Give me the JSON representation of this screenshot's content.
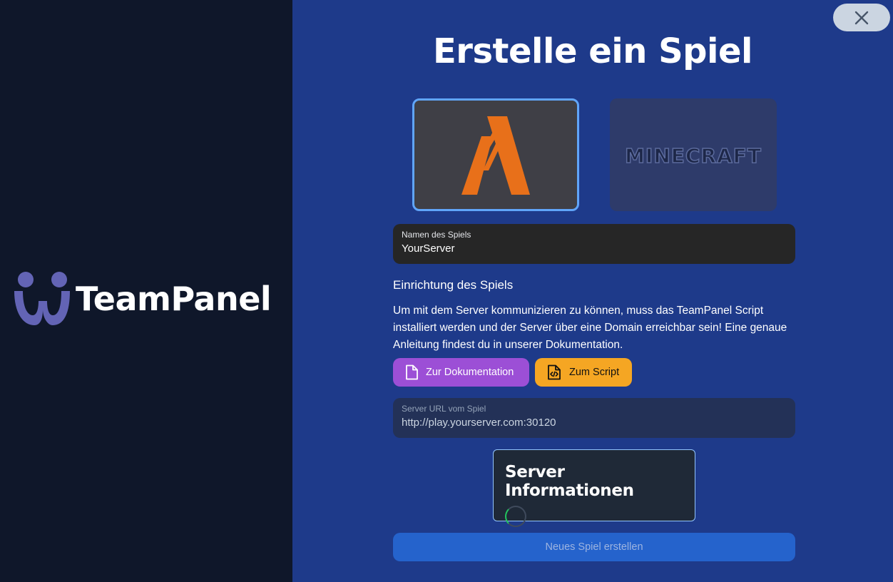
{
  "brand": {
    "name": "TeamPanel",
    "icon": "teampanel-logo"
  },
  "header": {
    "title": "Erstelle ein Spiel",
    "close_icon": "close-icon"
  },
  "games": [
    {
      "id": "fivem",
      "icon": "fivem-logo",
      "selected": true
    },
    {
      "id": "minecraft",
      "label": "MINECRAFT",
      "selected": false
    }
  ],
  "name_field": {
    "label": "Namen des Spiels",
    "value": "YourServer"
  },
  "setup": {
    "title": "Einrichtung des Spiels",
    "description": "Um mit dem Server kommunizieren zu können, muss das TeamPanel Script installiert werden und der Server über eine Domain erreichbar sein! Eine genaue Anleitung findest du in unserer Dokumentation.",
    "docs_button": "Zur Dokumentation",
    "script_button": "Zum Script"
  },
  "url_field": {
    "label": "Server URL vom Spiel",
    "placeholder": "http://play.yourserver.com:30120"
  },
  "server_info": {
    "title": "Server Informationen",
    "status": "loading"
  },
  "submit": {
    "label": "Neues Spiel erstellen",
    "enabled": false
  },
  "colors": {
    "accent_docs": "#9c4fd6",
    "accent_script": "#f5a623",
    "primary": "#2563cc",
    "background": "#1e3a8a",
    "sidebar": "#0f172a"
  }
}
